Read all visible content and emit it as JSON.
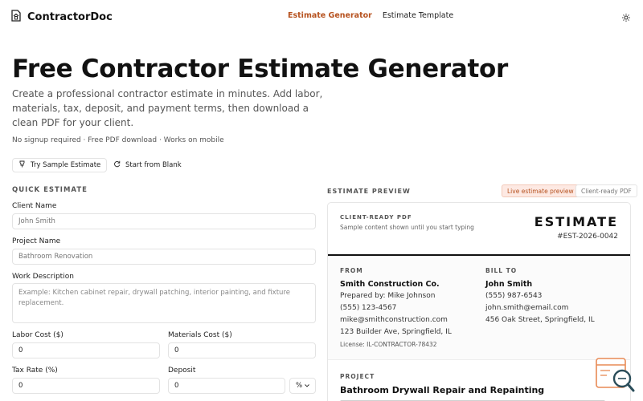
{
  "app": {
    "brand_name": "ContractorDoc",
    "accent_color": "#b6511e"
  },
  "nav": {
    "items": [
      {
        "label": "Estimate Generator",
        "active": true
      },
      {
        "label": "Estimate Template",
        "active": false
      }
    ],
    "theme_icon": "sun-icon"
  },
  "hero": {
    "title": "Free Contractor Estimate Generator",
    "subtitle": "Create a professional contractor estimate in minutes. Add labor, materials, tax, deposit, and payment terms, then download a clean PDF for your client.",
    "meta": "No signup required · Free PDF download · Works on mobile",
    "try_sample_label": "Try Sample Estimate",
    "start_blank_label": "Start from Blank"
  },
  "form": {
    "section_label": "QUICK ESTIMATE",
    "client_name": {
      "label": "Client Name",
      "placeholder": "John Smith"
    },
    "project_name": {
      "label": "Project Name",
      "placeholder": "Bathroom Renovation"
    },
    "work_description": {
      "label": "Work Description",
      "placeholder": "Example: Kitchen cabinet repair, drywall patching, interior painting, and fixture replacement."
    },
    "labor_cost": {
      "label": "Labor Cost ($)",
      "value": "0"
    },
    "materials_cost": {
      "label": "Materials Cost ($)",
      "value": "0"
    },
    "tax_rate": {
      "label": "Tax Rate (%)",
      "value": "0"
    },
    "deposit": {
      "label": "Deposit",
      "value": "0",
      "unit": "%"
    }
  },
  "preview": {
    "section_label": "ESTIMATE PREVIEW",
    "badge_live": "Live estimate preview",
    "badge_pdf": "Client-ready PDF",
    "kicker": "CLIENT-READY PDF",
    "note": "Sample content shown until you start typing",
    "title": "ESTIMATE",
    "number": "#EST-2026-0042",
    "from": {
      "label": "FROM",
      "company": "Smith Construction Co.",
      "prepared_by": "Prepared by: Mike Johnson",
      "phone": "(555) 123-4567",
      "email": "mike@smithconstruction.com",
      "address": "123 Builder Ave, Springfield, IL",
      "license": "License: IL-CONTRACTOR-78432"
    },
    "bill_to": {
      "label": "BILL TO",
      "name": "John Smith",
      "phone": "(555) 987-6543",
      "email": "john.smith@email.com",
      "address": "456 Oak Street, Springfield, IL"
    },
    "project": {
      "label": "PROJECT",
      "title": "Bathroom Drywall Repair and Repainting"
    }
  }
}
